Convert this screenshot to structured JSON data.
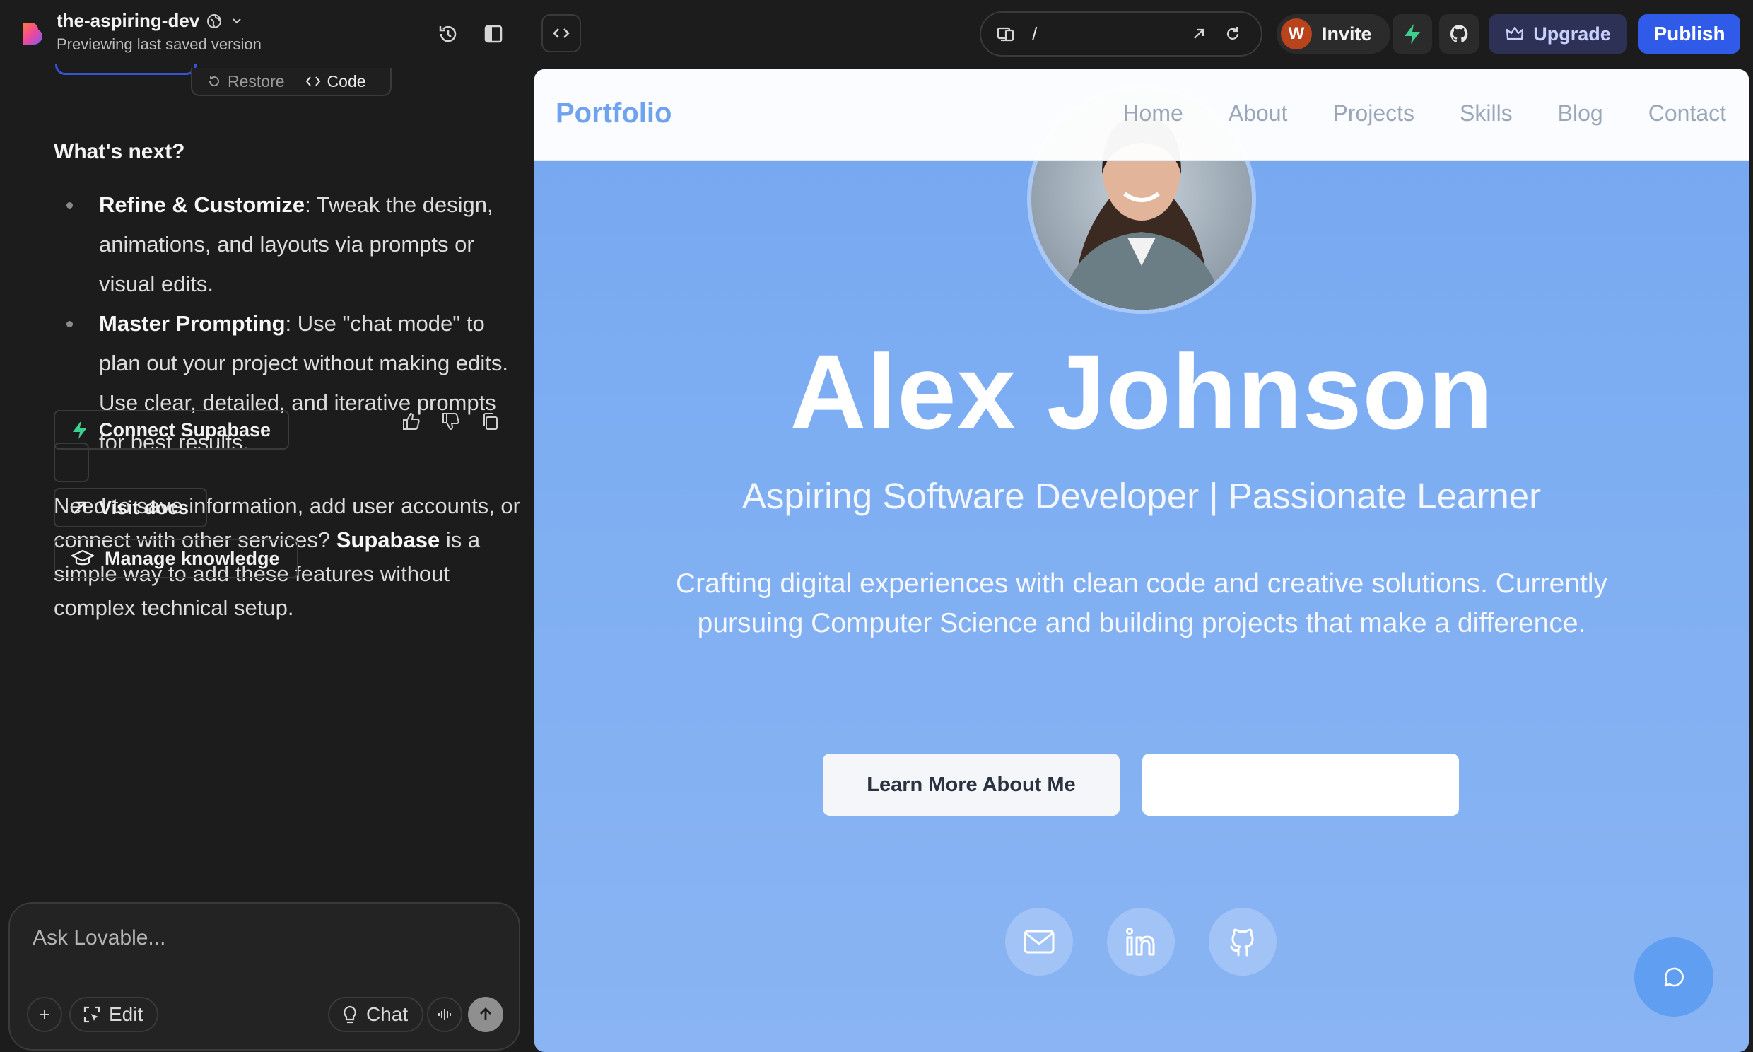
{
  "topbar": {
    "project_name": "the-aspiring-dev",
    "subtitle": "Previewing last saved version",
    "url_path": "/",
    "invite_label": "Invite",
    "avatar_letter": "W",
    "upgrade_label": "Upgrade",
    "publish_label": "Publish"
  },
  "chat": {
    "restore_label": "Restore",
    "code_label": "Code",
    "heading": "What's next?",
    "bullets": [
      {
        "title": "Refine & Customize",
        "text": ": Tweak the design, animations, and layouts via prompts or visual edits."
      },
      {
        "title": "Master Prompting",
        "text": ": Use \"chat mode\" to plan out your project without making edits. Use clear, detailed, and iterative prompts for best results."
      }
    ],
    "paragraph": {
      "before": "Need to save information, add user accounts, or connect with other services? ",
      "bold": "Supabase",
      "after": " is a simple way to add these features without complex technical setup."
    },
    "buttons": {
      "connect": "Connect Supabase",
      "docs": "Visit docs",
      "knowledge": "Manage knowledge"
    },
    "composer": {
      "placeholder": "Ask Lovable...",
      "edit_label": "Edit",
      "chat_label": "Chat"
    }
  },
  "preview": {
    "brand": "Portfolio",
    "nav": [
      "Home",
      "About",
      "Projects",
      "Skills",
      "Blog",
      "Contact"
    ],
    "name": "Alex Johnson",
    "tagline": "Aspiring Software Developer | Passionate Learner",
    "description": "Crafting digital experiences with clean code and creative solutions. Currently pursuing Computer Science and building projects that make a difference.",
    "primary_button": "Learn More About Me"
  },
  "colors": {
    "publish": "#2f5be8",
    "preview_bg": "#7eaef2",
    "brand": "#6fa3ee"
  }
}
